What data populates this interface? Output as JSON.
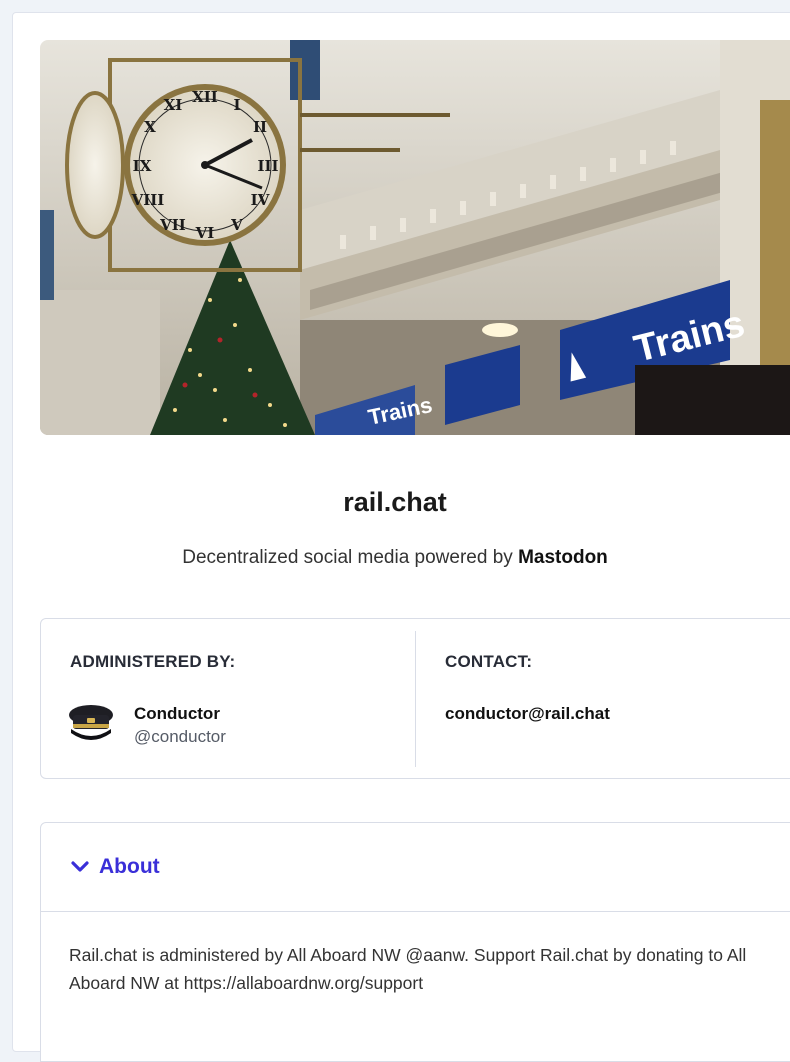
{
  "server": {
    "name": "rail.chat",
    "tagline_prefix": "Decentralized social media powered by",
    "tagline_brand": "Mastodon"
  },
  "hero": {
    "icon": "train-station-clock-image",
    "sign_text": "Trains"
  },
  "admin": {
    "heading": "ADMINISTERED BY:",
    "display_name": "Conductor",
    "handle": "@conductor",
    "avatar_icon": "conductor-cap-icon"
  },
  "contact": {
    "heading": "CONTACT:",
    "email": "conductor@rail.chat"
  },
  "about": {
    "label": "About",
    "expanded": true,
    "text": "Rail.chat is administered by All Aboard NW @aanw. Support Rail.chat by donating to All Aboard NW at https://allaboardnw.org/support"
  },
  "colors": {
    "accent": "#3a2fd8",
    "page_bg": "#eff3f8"
  }
}
